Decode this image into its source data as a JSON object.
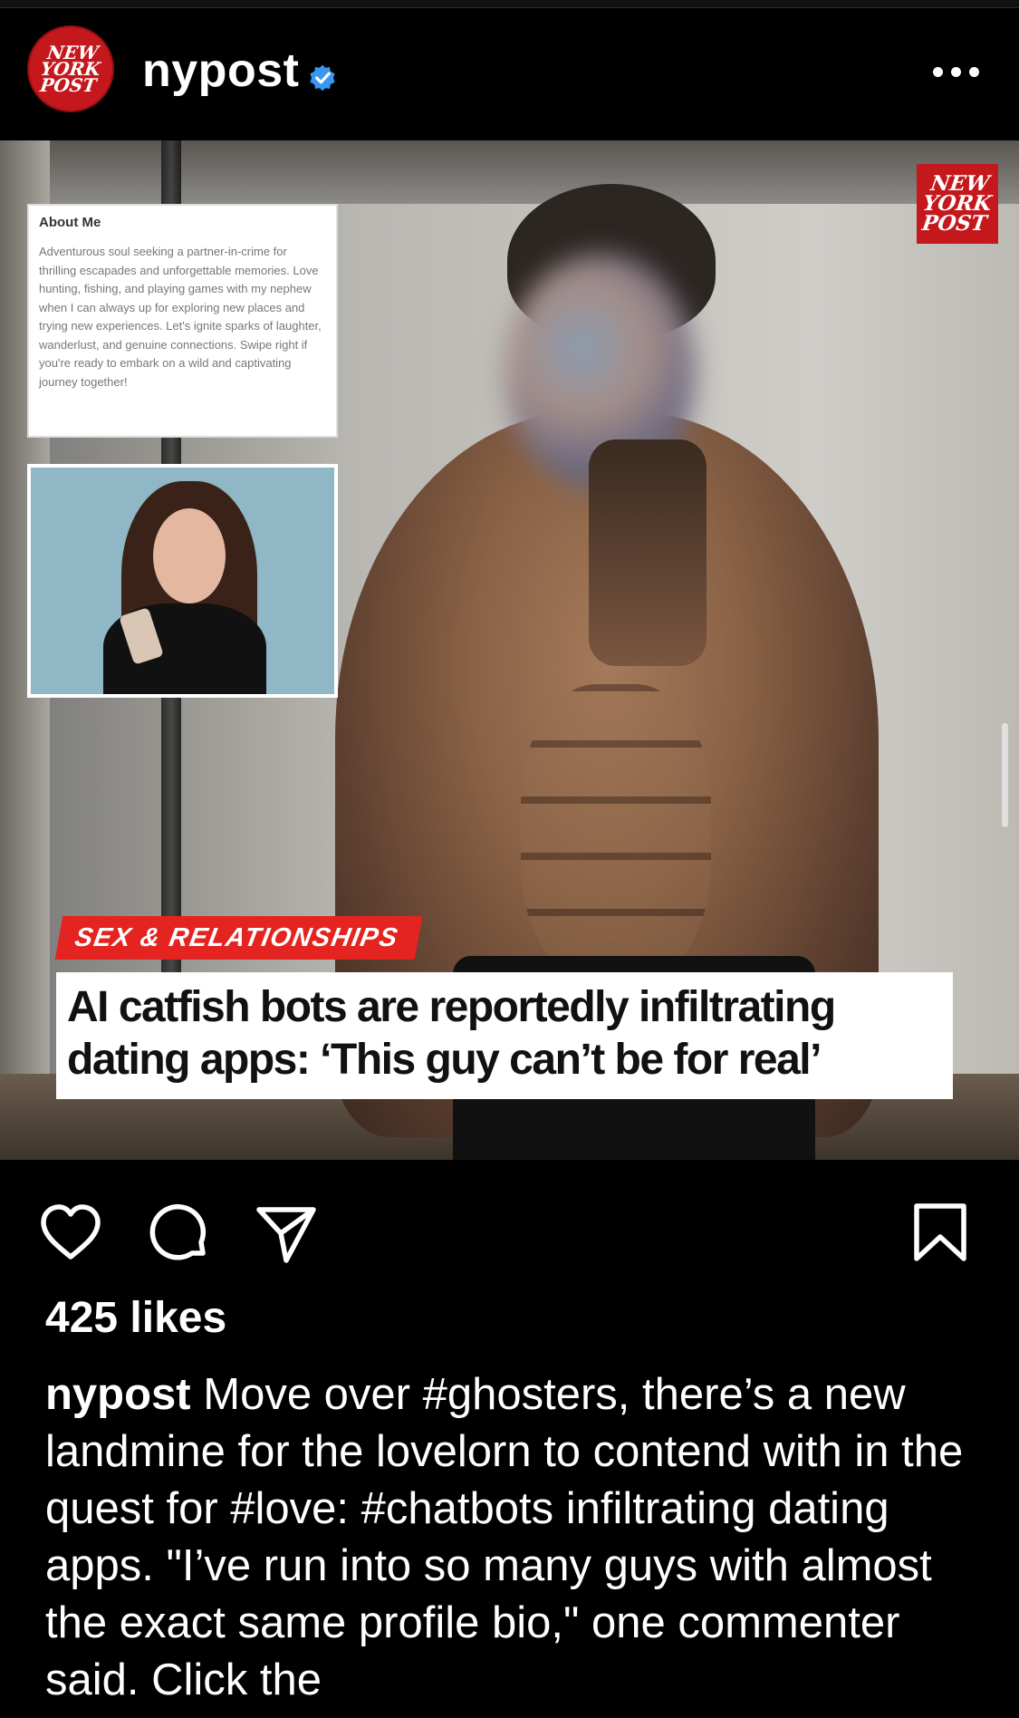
{
  "post": {
    "username": "nypost",
    "avatar_logo": "NEW\nYORK\nPOST",
    "verified_icon": "verified-badge-icon",
    "more_icon": "more-options-icon"
  },
  "image": {
    "corner_logo": "NEW\nYORK\nPOST",
    "about_card": {
      "title": "About Me",
      "text": "Adventurous soul seeking a partner-in-crime for thrilling escapades and unforgettable memories. Love hunting, fishing, and playing games with my nephew when I can always up for exploring new places and trying new experiences. Let's ignite sparks of laughter, wanderlust, and genuine connections. Swipe right if you're ready to embark on a wild and captivating journey together!"
    },
    "category": "SEX & RELATIONSHIPS",
    "headline": "AI catfish bots are reportedly infiltrating dating apps: ‘This guy can’t be for real’"
  },
  "actions": {
    "like_icon": "heart-icon",
    "comment_icon": "comment-icon",
    "share_icon": "share-icon",
    "save_icon": "bookmark-icon"
  },
  "likes": "425 likes",
  "caption": {
    "username": "nypost",
    "text": "Move over #ghosters, there’s a new landmine for the lovelorn to contend with in the quest for #love: #chatbots infiltrating dating apps. \"I’ve run into so many guys with almost the exact same profile bio,\" one commenter said. Click the"
  },
  "colors": {
    "background": "#000000",
    "brand_red": "#c4181c",
    "tag_red": "#e32420",
    "verified_blue": "#3897f0"
  }
}
